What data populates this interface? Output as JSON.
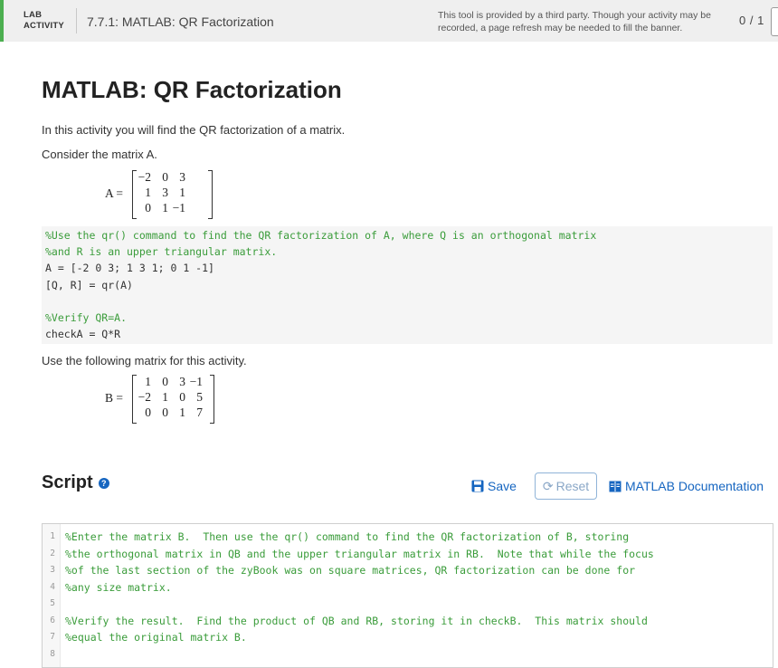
{
  "banner": {
    "lab_line1": "LAB",
    "lab_line2": "ACTIVITY",
    "title": "7.7.1: MATLAB: QR Factorization",
    "notice_line1": "This tool is provided by a third party. Though your activity may be",
    "notice_line2": "recorded, a page refresh may be needed to fill the banner.",
    "score": "0 / 1"
  },
  "page": {
    "title": "MATLAB: QR Factorization",
    "intro": "In this activity you will find the QR factorization of a matrix.",
    "consider": "Consider the matrix A.",
    "use_following": "Use the following matrix for this activity."
  },
  "matrix_a": {
    "name": "A =",
    "rows": [
      [
        "−2",
        "0",
        "3"
      ],
      [
        "1",
        "3",
        "1"
      ],
      [
        "0",
        "1",
        "−1"
      ]
    ]
  },
  "matrix_b": {
    "name": "B =",
    "rows": [
      [
        "1",
        "0",
        "3",
        "−1"
      ],
      [
        "−2",
        "1",
        "0",
        "5"
      ],
      [
        "0",
        "0",
        "1",
        "7"
      ]
    ]
  },
  "example_code": [
    {
      "text": "%Use the qr() command to find the QR factorization of A, where Q is an orthogonal matrix",
      "kind": "comment"
    },
    {
      "text": "%and R is an upper triangular matrix.",
      "kind": "comment"
    },
    {
      "text": "A = [-2 0 3; 1 3 1; 0 1 -1]",
      "kind": "code"
    },
    {
      "text": "[Q, R] = qr(A)",
      "kind": "code"
    },
    {
      "text": "",
      "kind": "code"
    },
    {
      "text": "%Verify QR=A.",
      "kind": "comment"
    },
    {
      "text": "checkA = Q*R",
      "kind": "code"
    }
  ],
  "script": {
    "title": "Script",
    "save_label": "Save",
    "reset_label": "Reset",
    "docs_label": "MATLAB Documentation"
  },
  "editor_lines": [
    {
      "num": "1",
      "text": "%Enter the matrix B.  Then use the qr() command to find the QR factorization of B, storing"
    },
    {
      "num": "2",
      "text": "%the orthogonal matrix in QB and the upper triangular matrix in RB.  Note that while the focus"
    },
    {
      "num": "3",
      "text": "%of the last section of the zyBook was on square matrices, QR factorization can be done for"
    },
    {
      "num": "4",
      "text": "%any size matrix."
    },
    {
      "num": "5",
      "text": ""
    },
    {
      "num": "6",
      "text": "%Verify the result.  Find the product of QB and RB, storing it in checkB.  This matrix should"
    },
    {
      "num": "7",
      "text": "%equal the original matrix B."
    },
    {
      "num": "8",
      "text": ""
    }
  ],
  "colors": {
    "accent": "#4caf50",
    "link": "#1565c0",
    "comment": "#3a9c3a"
  }
}
